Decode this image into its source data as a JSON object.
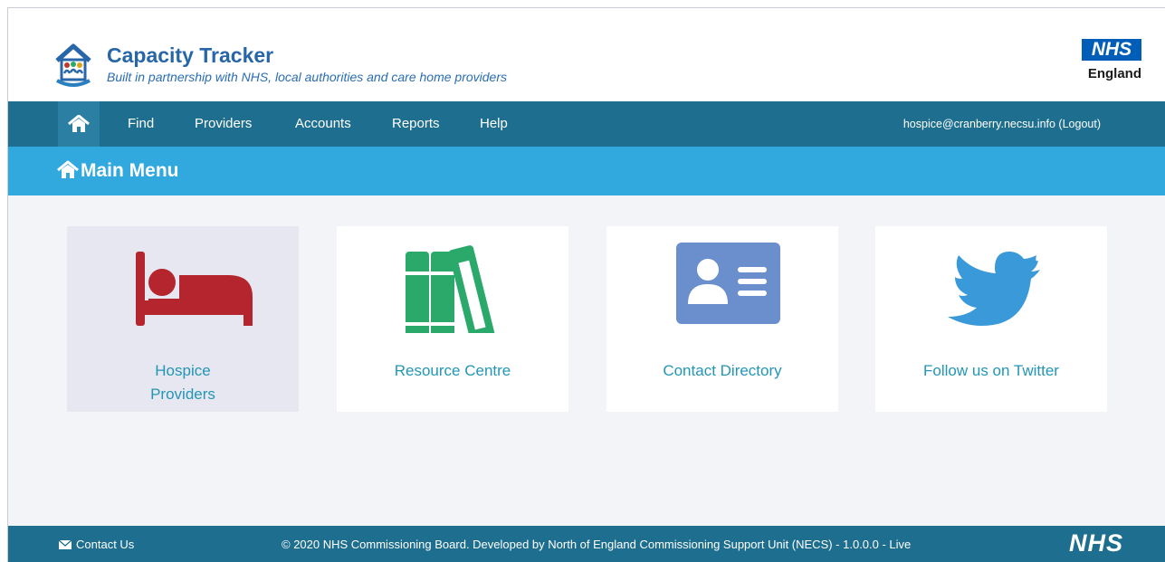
{
  "brand": {
    "title": "Capacity Tracker",
    "subtitle": "Built in partnership with NHS, local authorities and care home providers",
    "nhs_logo": "NHS",
    "nhs_region": "England"
  },
  "nav": {
    "home_icon": "home-icon",
    "items": [
      "Find",
      "Providers",
      "Accounts",
      "Reports",
      "Help"
    ],
    "user": "hospice@cranberry.necsu.info (Logout)"
  },
  "page": {
    "title": "Main Menu",
    "title_icon": "home-icon"
  },
  "tiles": [
    {
      "label_line1": "Hospice",
      "label_line2": "Providers",
      "icon": "bed-icon",
      "color": "#b4252d",
      "selected": true
    },
    {
      "label": "Resource Centre",
      "icon": "books-icon",
      "color": "#2aa96b"
    },
    {
      "label": "Contact Directory",
      "icon": "address-card-icon",
      "color": "#6a8fcc"
    },
    {
      "label": "Follow us on Twitter",
      "icon": "twitter-icon",
      "color": "#3a99d8"
    }
  ],
  "footer": {
    "contact": "Contact Us",
    "copyright": "© 2020 NHS Commissioning Board. Developed by North of England Commissioning Support Unit (NECS) - 1.0.0.0 - Live",
    "nhs_logo": "NHS"
  },
  "colors": {
    "nav": "#1e6e8f",
    "titlebar": "#31a9de",
    "tile_label": "#2396b5"
  }
}
